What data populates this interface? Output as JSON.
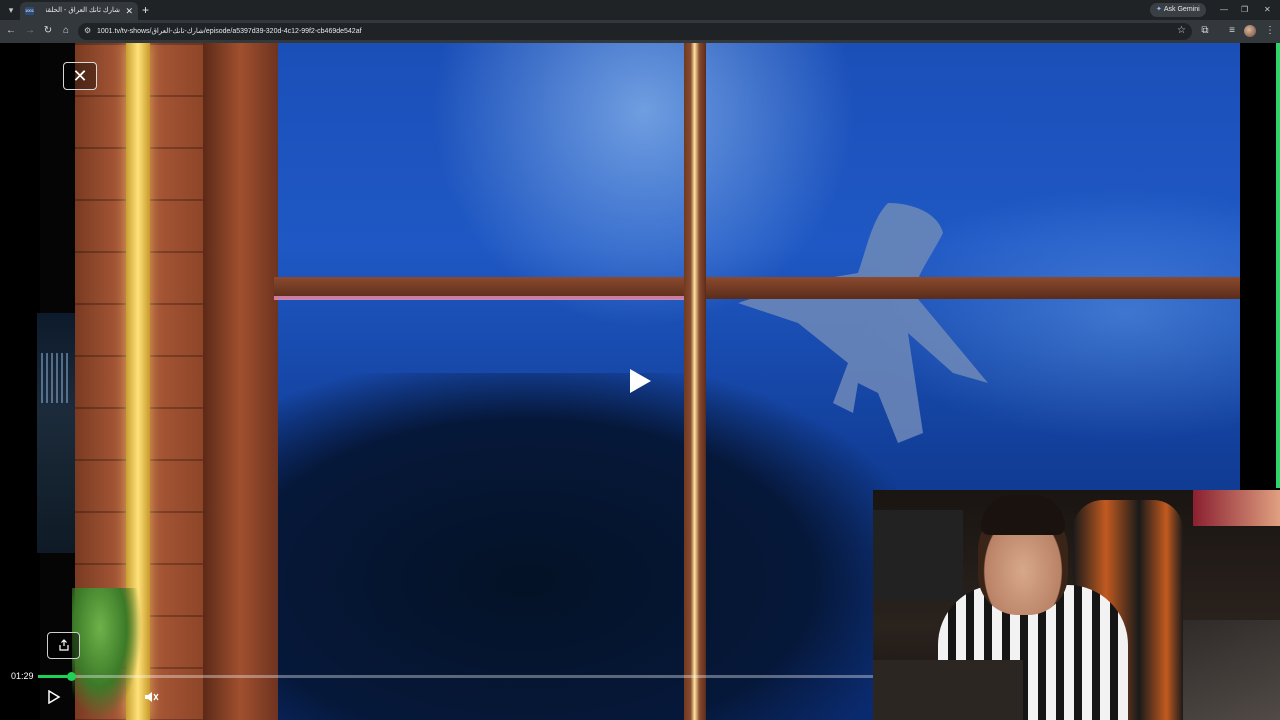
{
  "browser": {
    "tab_title": "شارك ثانك العراق - الحلقة 11",
    "favicon_text": "1001",
    "ask_gemini": "Ask Gemini",
    "url": "1001.tv/tv-shows/شارك-تانك-العراق/episode/a5397d39-320d-4c12-99f2-cb469de542af"
  },
  "player": {
    "current_time": "01:29",
    "progress_fraction": 0.04,
    "accent_color": "#1fd156"
  },
  "icons": {
    "close": "close-icon",
    "play": "play-icon",
    "share": "share-icon",
    "mute": "mute-icon"
  }
}
